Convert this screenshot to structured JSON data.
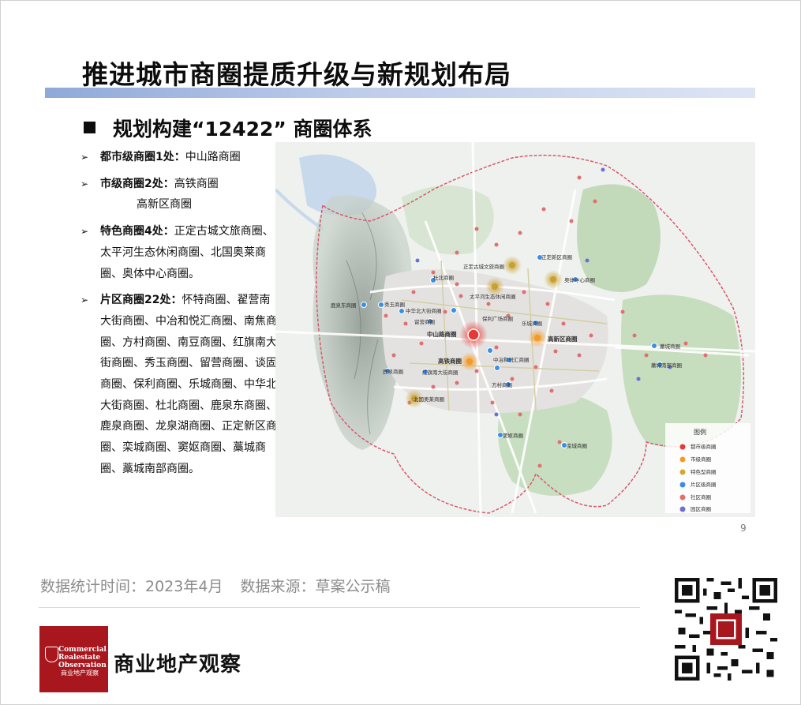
{
  "slide": {
    "title": "推进城市商圈提质升级与新规划布局",
    "subtitle": "规划构建“12422” 商圈体系",
    "page_number": "9"
  },
  "tiers": [
    {
      "label": "都市级商圈1处",
      "sep": "：",
      "text": "中山路商圈",
      "extra": ""
    },
    {
      "label": "市级商圈2处",
      "sep": "：",
      "text": "高铁商圈",
      "extra": "高新区商圈"
    },
    {
      "label": "特色商圈4处",
      "sep": "：",
      "text": "正定古城文旅商圈、太平河生态休闲商圈、北国奥莱商圈、奥体中心商圈。",
      "extra": ""
    },
    {
      "label": "片区商圈22处",
      "sep": "：",
      "text": "怀特商圈、翟营南大街商圈、中冶和悦汇商圈、南焦商圈、方村商圈、南豆商圈、红旗南大街商圈、秀玉商圈、留营商圈、谈固商圈、保利商圈、乐城商圈、中华北大街商圈、杜北商圈、鹿泉东商圈、鹿泉商圈、龙泉湖商圈、正定新区商圈、栾城商圈、窦妪商圈、藁城商圈、藁城南部商圈。",
      "extra": ""
    }
  ],
  "map": {
    "labels": {
      "zhengding_old_town": "正定古城文旅商圈",
      "zhengding_new_area": "正定新区商圈",
      "aoti": "奥体中心商圈",
      "duobei": "杜北商圈",
      "taiping_river": "太平河生态休闲商圈",
      "luquan_east": "鹿泉东商圈",
      "xiuyu": "秀玉商圈",
      "zhonghua_north": "中华北大街商圈",
      "baoli": "保利广场商圈",
      "liuying": "留营商圈",
      "zhongshan": "中山路商圈",
      "lecheng": "乐城商圈",
      "gaoxin": "高新区商圈",
      "gaotie": "高铁商圈",
      "hongqi": "红旗南大街商圈",
      "zhongye": "中冶和悦汇商圈",
      "luquan": "鹿泉商圈",
      "fangcun": "方村商圈",
      "gaocheng": "藁城商圈",
      "gaocheng_south": "藁城南部商圈",
      "beiguo_outlet": "北国奥莱商圈",
      "douyu": "窦妪商圈",
      "luancheng": "栾城商圈"
    },
    "legend": {
      "title": "图例",
      "items": [
        {
          "label": "都市级商圈",
          "color": "#e53935"
        },
        {
          "label": "市级商圈",
          "color": "#f59a23"
        },
        {
          "label": "特色型商圈",
          "color": "#d4a72c"
        },
        {
          "label": "片区级商圈",
          "color": "#3a8ee6"
        },
        {
          "label": "社区商圈",
          "color": "#e07070"
        },
        {
          "label": "园区商圈",
          "color": "#6b6fd6"
        }
      ]
    }
  },
  "footer": {
    "stats_time": "数据统计时间：2023年4月",
    "source": "数据来源：草案公示稿",
    "logo_line1": "Commercial",
    "logo_line2": "Realestate",
    "logo_line3": "Observation",
    "logo_cn": "商业地产观察",
    "brand_name": "商业地产观察"
  }
}
